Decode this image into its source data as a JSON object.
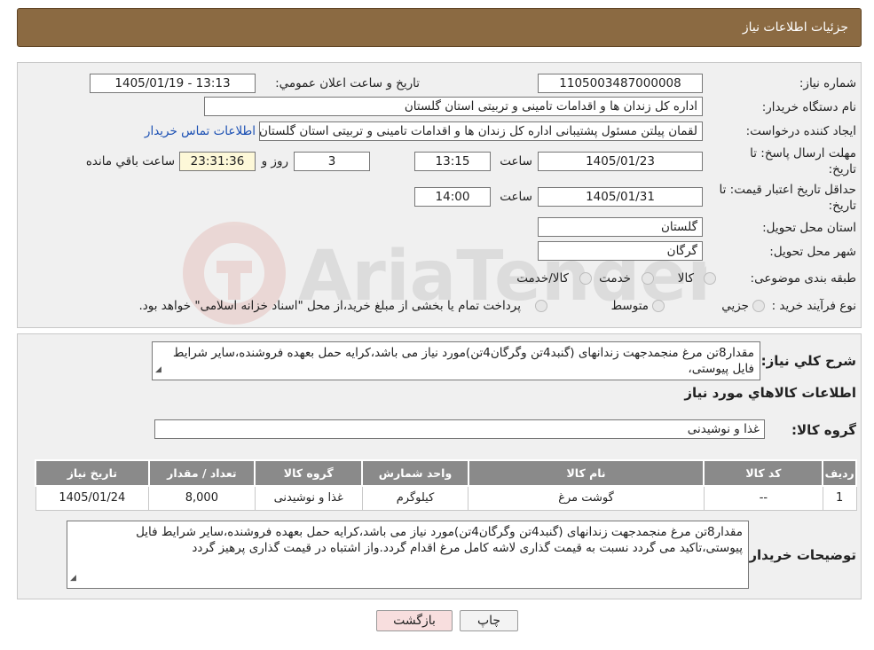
{
  "header": {
    "title": "جزئیات اطلاعات نیاز"
  },
  "form": {
    "need_number_label": "شماره نیاز:",
    "need_number": "1105003487000008",
    "announce_label": "تاریخ و ساعت اعلان عمومي:",
    "announce_value": "1405/01/19 - 13:13",
    "buyer_label": "نام دستگاه خريدار:",
    "buyer_value": "اداره کل زندان ها و اقدامات تامینی و تربیتی استان گلستان",
    "creator_label": "ایجاد کننده درخواست:",
    "creator_value": "لقمان پیلتن مسئول پشتیبانی اداره کل زندان ها و اقدامات تامینی و تربیتی استان گلستان",
    "contact_link": "اطلاعات تماس خریدار",
    "reply_deadline_label_1": "مهلت ارسال پاسخ: تا",
    "reply_deadline_label_2": "تاریخ:",
    "reply_date": "1405/01/23",
    "time_label": "ساعت",
    "reply_time": "13:15",
    "days_value": "3",
    "days_label": "روز و",
    "remaining_time": "23:31:36",
    "remaining_label": "ساعت باقي مانده",
    "validity_label_1": "حداقل تاریخ اعتبار قیمت: تا",
    "validity_label_2": "تاریخ:",
    "validity_date": "1405/01/31",
    "validity_time_label": "ساعت",
    "validity_time": "14:00",
    "province_label": "استان محل تحویل:",
    "province_value": "گلستان",
    "city_label": "شهر محل تحویل:",
    "city_value": "گرگان",
    "category_label": "طبقه بندی موضوعی:",
    "category_options": [
      "کالا",
      "خدمت",
      "کالا/خدمت"
    ],
    "process_label": "نوع فرآیند خرید :",
    "process_options": [
      "جزيي",
      "متوسط"
    ],
    "process_note": "پرداخت تمام یا بخشی از مبلغ خرید،از محل \"اسناد خزانه اسلامی\" خواهد بود."
  },
  "description": {
    "label": "شرح کلي نياز:",
    "text": "مقدار8تن مرغ منجمدجهت زندانهای (گنبد4تن وگرگان4تن)مورد نیاز می باشد،کرایه حمل بعهده فروشنده،سایر شرایط فایل پیوستی،"
  },
  "goods": {
    "section_title": "اطلاعات کالاهاي مورد نياز",
    "group_label": "گروه کالا:",
    "group_value": "غذا و نوشیدنی",
    "columns": [
      "رديف",
      "کد کالا",
      "نام کالا",
      "واحد شمارش",
      "گروه کالا",
      "تعداد / مقدار",
      "تاريخ نياز"
    ],
    "rows": [
      [
        "1",
        "--",
        "گوشت مرغ",
        "کیلوگرم",
        "غذا و نوشیدنی",
        "8,000",
        "1405/01/24"
      ]
    ]
  },
  "buyer_notes": {
    "label": "توضیحات خریدار:",
    "text": "مقدار8تن مرغ منجمدجهت زندانهای (گنبد4تن وگرگان4تن)مورد نیاز می باشد،کرایه حمل بعهده فروشنده،سایر شرایط فایل پیوستی،تاکید می گردد نسبت به قیمت گذاری لاشه کامل مرغ اقدام گردد.واز اشتباه در قیمت گذاری پرهیز گردد"
  },
  "buttons": {
    "print": "چاپ",
    "back": "بازگشت"
  },
  "watermark": {
    "text": "AriaTender.neT"
  },
  "colors": {
    "header_bg": "#8b6a42",
    "table_header_bg": "#8a8a8a",
    "link": "#1a4fb3",
    "back_button_bg": "#f8dede"
  }
}
